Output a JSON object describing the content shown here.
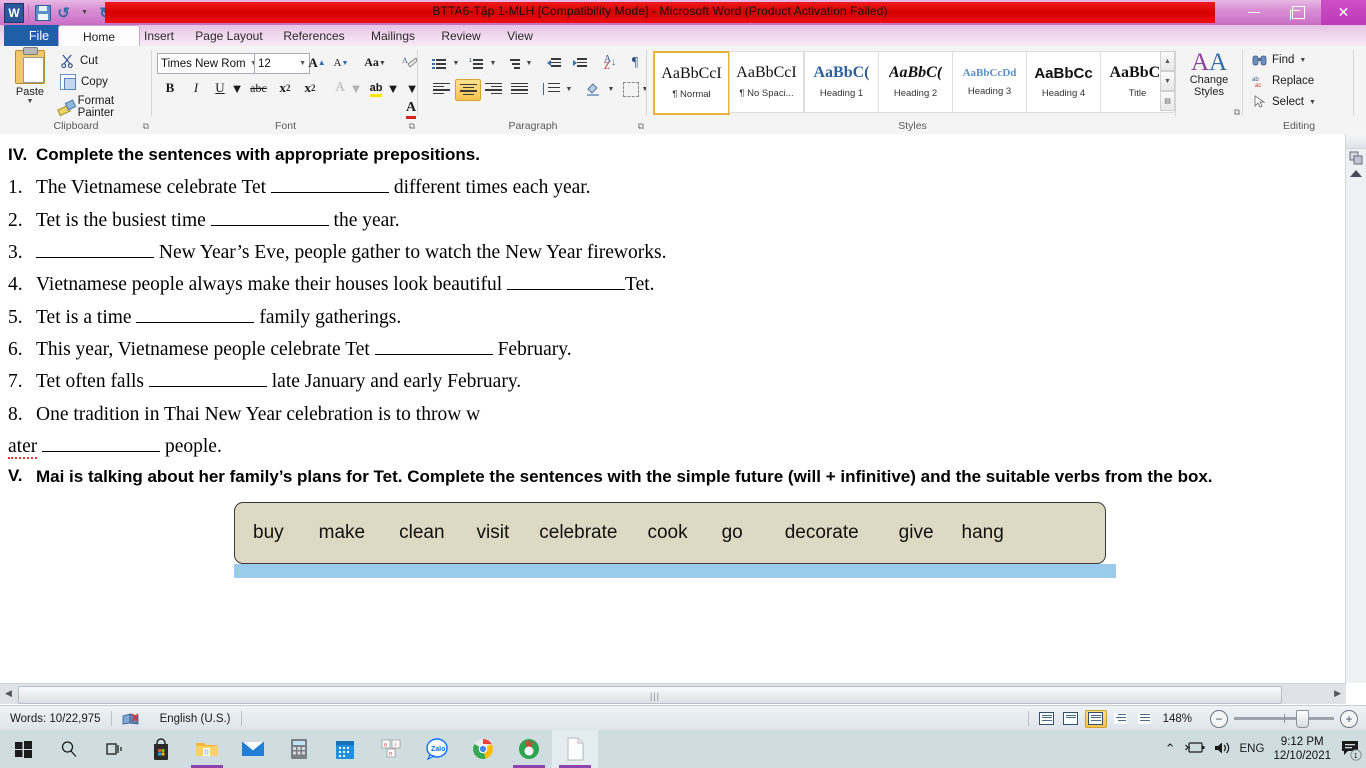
{
  "window": {
    "title": "BTTA6-Tập 1-MLH [Compatibility Mode]  -  Microsoft Word (Product Activation Failed)",
    "app_badge": "W",
    "minimize": "–",
    "restore": "Restore",
    "close": "✕",
    "help": "?"
  },
  "quick_access": {
    "save": "save-icon",
    "undo": "↺",
    "redo": "↻",
    "customize": "▾"
  },
  "tabs": [
    {
      "label": "File",
      "active": false,
      "file": true
    },
    {
      "label": "Home",
      "active": true
    },
    {
      "label": "Insert",
      "active": false
    },
    {
      "label": "Page Layout",
      "active": false
    },
    {
      "label": "References",
      "active": false
    },
    {
      "label": "Mailings",
      "active": false
    },
    {
      "label": "Review",
      "active": false
    },
    {
      "label": "View",
      "active": false
    }
  ],
  "ribbon": {
    "clipboard": {
      "label": "Clipboard",
      "paste": "Paste",
      "cut": "Cut",
      "copy": "Copy",
      "format_painter": "Format Painter"
    },
    "font": {
      "label": "Font",
      "font_name": "Times New Rom",
      "font_size": "12",
      "grow": "A",
      "shrink": "A",
      "change_case": "Aa",
      "clear_formatting": "clear-formatting-icon",
      "bold": "B",
      "italic": "I",
      "underline": "U",
      "strikethrough": "abc",
      "subscript": "x₂",
      "superscript": "x²",
      "text_effects": "A",
      "highlight": "ab",
      "font_color": "A"
    },
    "paragraph": {
      "label": "Paragraph",
      "bullets": "bullets-icon",
      "numbering": "numbering-icon",
      "multilevel": "multilevel-list-icon",
      "decrease_indent": "decrease-indent-icon",
      "increase_indent": "increase-indent-icon",
      "sort": "sort-icon",
      "show_marks": "¶",
      "align_left": "align-left-icon",
      "align_center": "align-center-icon",
      "align_right": "align-right-icon",
      "justify": "justify-icon",
      "line_spacing": "line-spacing-icon",
      "shading": "shading-icon",
      "borders": "borders-icon"
    },
    "styles": {
      "label": "Styles",
      "items": [
        {
          "preview": "AaBbCcI",
          "name": "¶ Normal",
          "selected": true
        },
        {
          "preview": "AaBbCcI",
          "name": "¶ No Spaci...",
          "selected": false
        },
        {
          "preview": "AaBbC(",
          "name": "Heading 1",
          "selected": false
        },
        {
          "preview": "AaBbC(",
          "name": "Heading 2",
          "selected": false
        },
        {
          "preview": "AaBbCcDd",
          "name": "Heading 3",
          "selected": false
        },
        {
          "preview": "AaBbCc",
          "name": "Heading 4",
          "selected": false
        },
        {
          "preview": "AaBbC(",
          "name": "Title",
          "selected": false
        }
      ],
      "change_styles": "Change\nStyles",
      "change_styles_line1": "Change",
      "change_styles_line2": "Styles"
    },
    "editing": {
      "label": "Editing",
      "find": "Find",
      "replace": "Replace",
      "select": "Select"
    }
  },
  "document": {
    "section_iv": {
      "number": "IV.",
      "title": "Complete the sentences with appropriate prepositions."
    },
    "questions": [
      {
        "num": "1.",
        "pre": "The Vietnamese celebrate Tet ",
        "post": " different times each year."
      },
      {
        "num": "2.",
        "pre": "Tet is the busiest time ",
        "post": " the year."
      },
      {
        "num": "3.",
        "pre": "",
        "post": " New Year’s Eve, people gather to watch the New Year fireworks."
      },
      {
        "num": "4.",
        "pre": "Vietnamese people always make their houses look beautiful ",
        "post": "Tet."
      },
      {
        "num": "5.",
        "pre": "Tet is a time ",
        "post": " family gatherings."
      },
      {
        "num": "6.",
        "pre": "This year, Vietnamese people celebrate Tet ",
        "post": " February."
      },
      {
        "num": "7.",
        "pre": "Tet often falls ",
        "post": " late January and early February."
      },
      {
        "num": "8.",
        "pre": "One tradition in Thai New Year celebration is to throw w",
        "post": ""
      }
    ],
    "wrapped_line": {
      "misspelled": "ater",
      "post": " people."
    },
    "section_v": {
      "number": "V.",
      "title": "Mai is talking about her family’s plans for Tet. Complete the sentences with the simple future (will + infinitive) and the suitable verbs from the box."
    },
    "word_box": [
      "buy",
      "make",
      "clean",
      "visit",
      "celebrate",
      "cook",
      "go",
      "decorate",
      "give",
      "hang"
    ]
  },
  "status_bar": {
    "words": "Words: 10/22,975",
    "proofing": "proofing-errors-icon",
    "language": "English (U.S.)",
    "zoom": "148%",
    "zoom_out": "−",
    "zoom_in": "+",
    "views": [
      "print-layout-icon",
      "full-screen-reading-icon",
      "web-layout-icon",
      "outline-icon",
      "draft-icon"
    ],
    "selected_view_index": 2
  },
  "taskbar": {
    "start": "start-icon",
    "search": "search-icon",
    "task_view": "task-view-icon",
    "apps": [
      {
        "name": "microsoft-store-icon"
      },
      {
        "name": "file-explorer-icon",
        "open": true
      },
      {
        "name": "mail-icon"
      },
      {
        "name": "calculator-icon"
      },
      {
        "name": "calendar-icon"
      },
      {
        "name": "unikey-icon"
      },
      {
        "name": "zalo-icon",
        "label": "Zalo"
      },
      {
        "name": "chrome-icon"
      },
      {
        "name": "coccoc-icon",
        "open": true
      },
      {
        "name": "word-document-icon",
        "active": true
      }
    ],
    "tray": {
      "show_hidden": "⌃",
      "battery": "battery-icon",
      "volume": "volume-icon",
      "language": "ENG",
      "time": "9:12 PM",
      "date": "12/10/2021",
      "notifications": "notification-icon",
      "notification_count": "1"
    }
  },
  "colors": {
    "title_red": "#e01010",
    "title_purple": "#cf7fcb",
    "file_tab_blue": "#1e5fa8",
    "wordbox_bg": "#ded9c3",
    "selection_blue": "#9bcbeb",
    "taskbar_bg": "#cfdde1",
    "accent_gold": "#e8b33c"
  }
}
